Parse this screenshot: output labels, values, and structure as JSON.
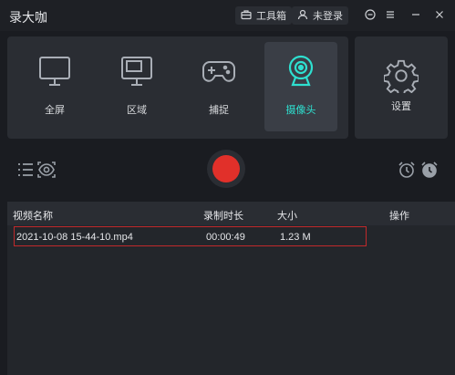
{
  "app": {
    "title": "录大咖"
  },
  "titlebar": {
    "toolbox_label": "工具箱",
    "login_label": "未登录"
  },
  "modes": [
    {
      "label": "全屏",
      "icon": "monitor-icon",
      "active": false
    },
    {
      "label": "区域",
      "icon": "region-icon",
      "active": false
    },
    {
      "label": "捕捉",
      "icon": "gamepad-icon",
      "active": false
    },
    {
      "label": "摄像头",
      "icon": "webcam-icon",
      "active": true
    }
  ],
  "settings": {
    "label": "设置",
    "icon": "gear-icon"
  },
  "table": {
    "columns": [
      "视频名称",
      "录制时长",
      "大小",
      "操作"
    ],
    "rows": [
      {
        "name": "2021-10-08 15-44-10.mp4",
        "duration": "00:00:49",
        "size": "1.23 M"
      }
    ]
  },
  "colors": {
    "accent": "#2ee0d0",
    "record": "#e1302a",
    "selection_border": "#c0292b"
  }
}
